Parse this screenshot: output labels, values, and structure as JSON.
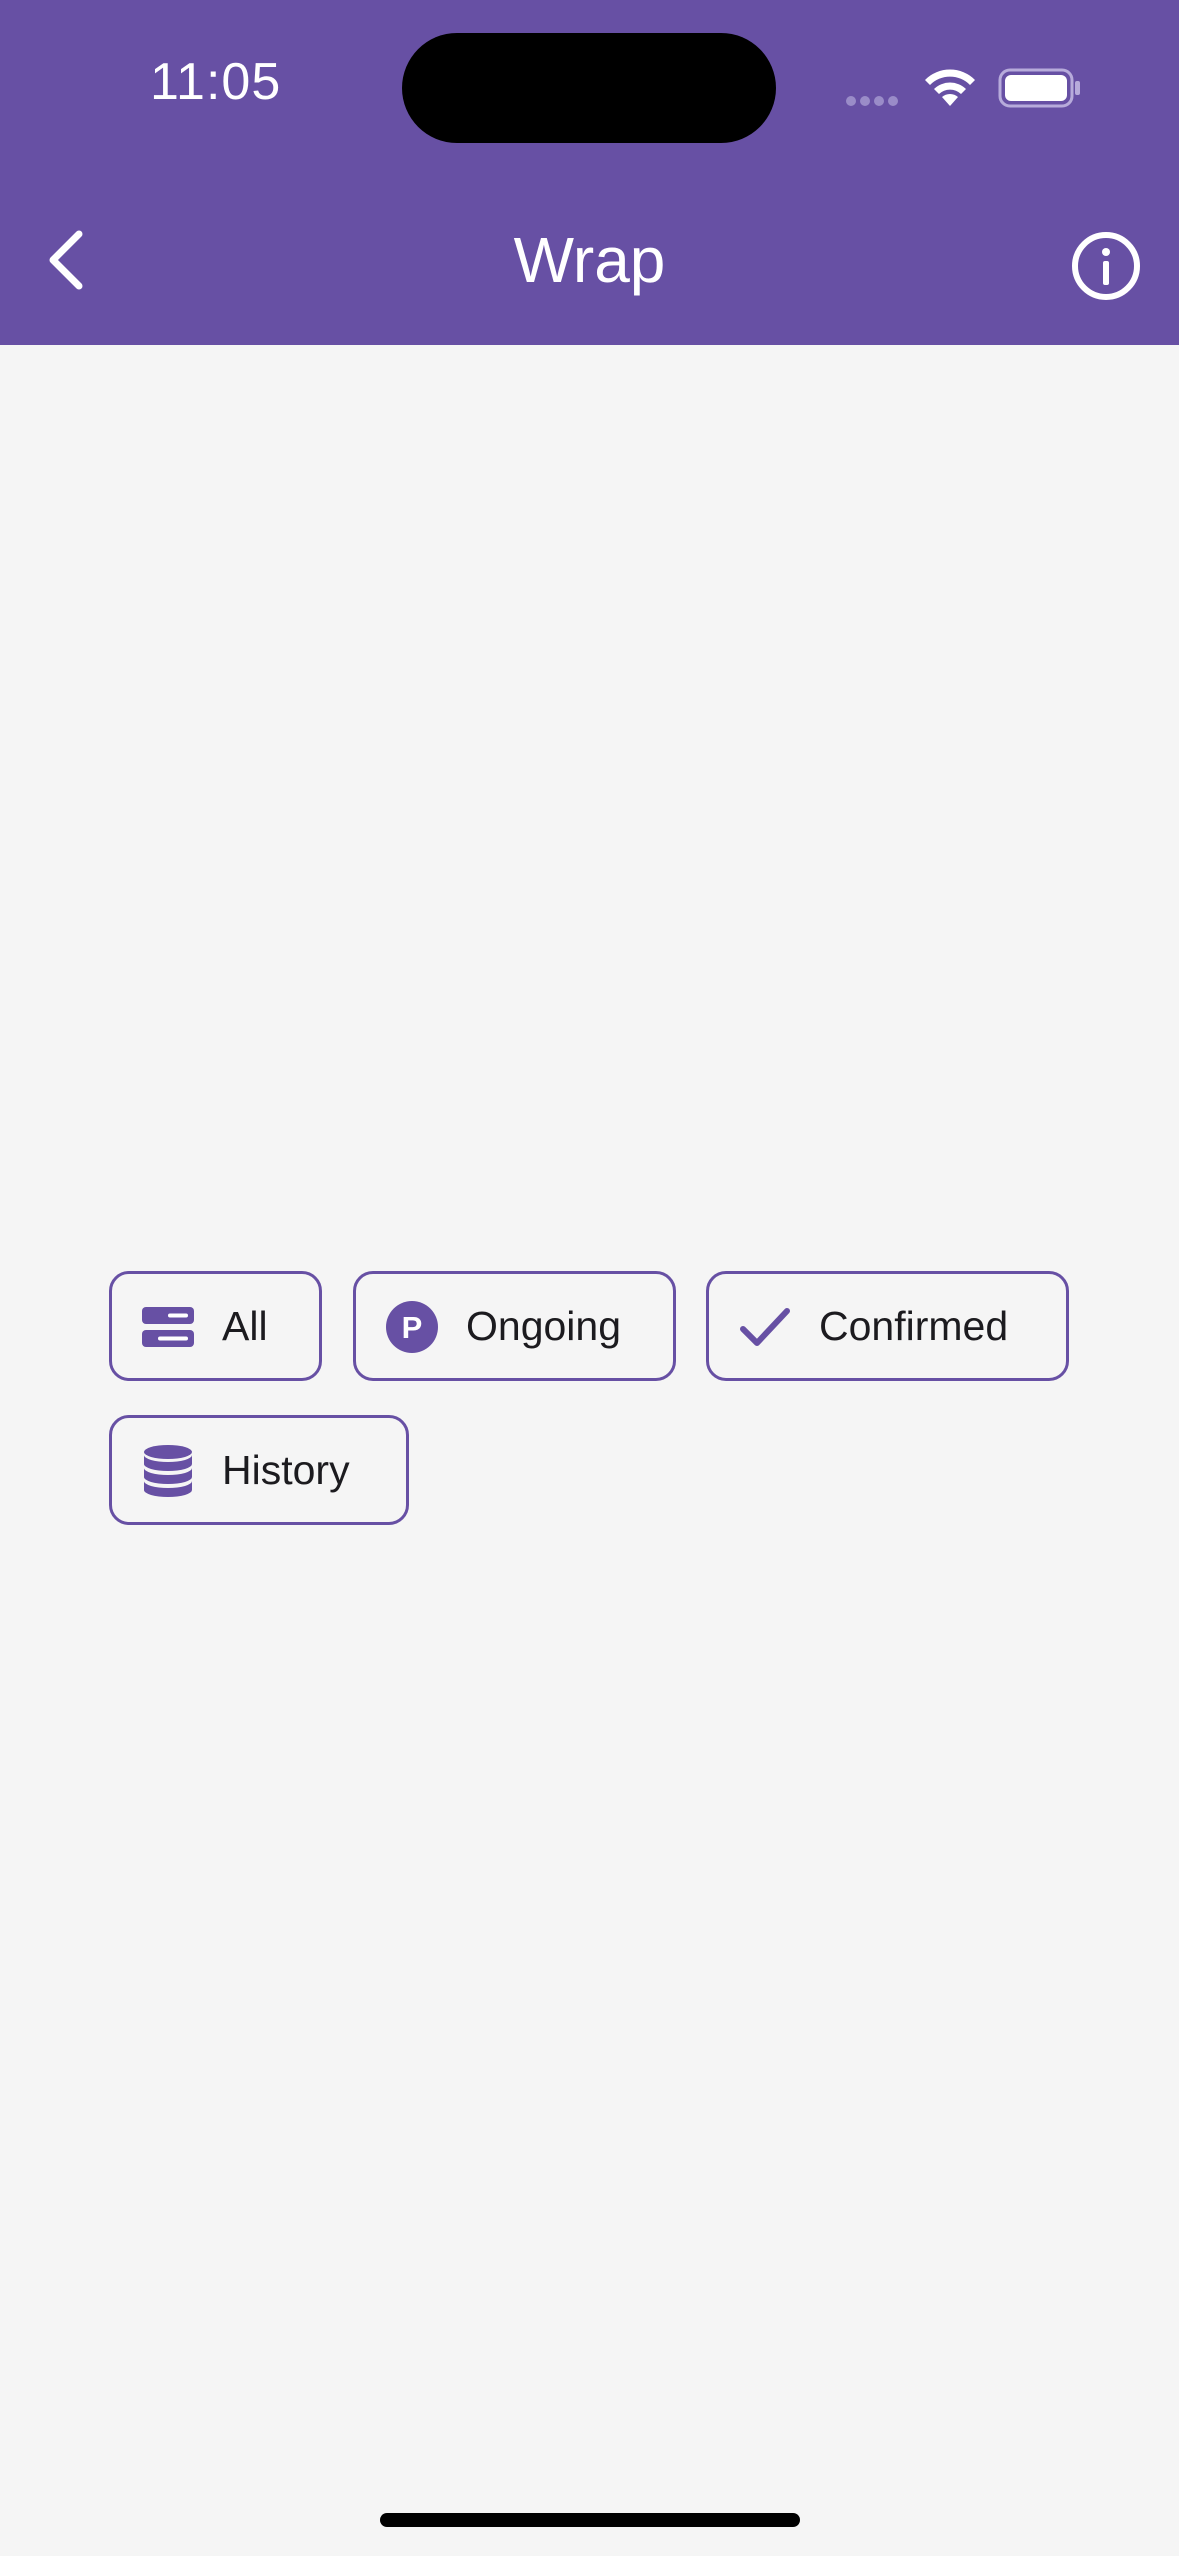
{
  "status_bar": {
    "time": "11:05"
  },
  "app_bar": {
    "title": "Wrap",
    "back_icon": "chevron-left-icon",
    "info_icon": "info-circle-icon"
  },
  "chips": [
    {
      "label": "All",
      "icon": "list-icon"
    },
    {
      "label": "Ongoing",
      "icon": "letter-p-circle-icon"
    },
    {
      "label": "Confirmed",
      "icon": "check-icon"
    },
    {
      "label": "History",
      "icon": "database-icon"
    }
  ],
  "colors": {
    "primary": "#6750a4",
    "background": "#f5f5f5",
    "on_surface": "#1c1b1f"
  }
}
